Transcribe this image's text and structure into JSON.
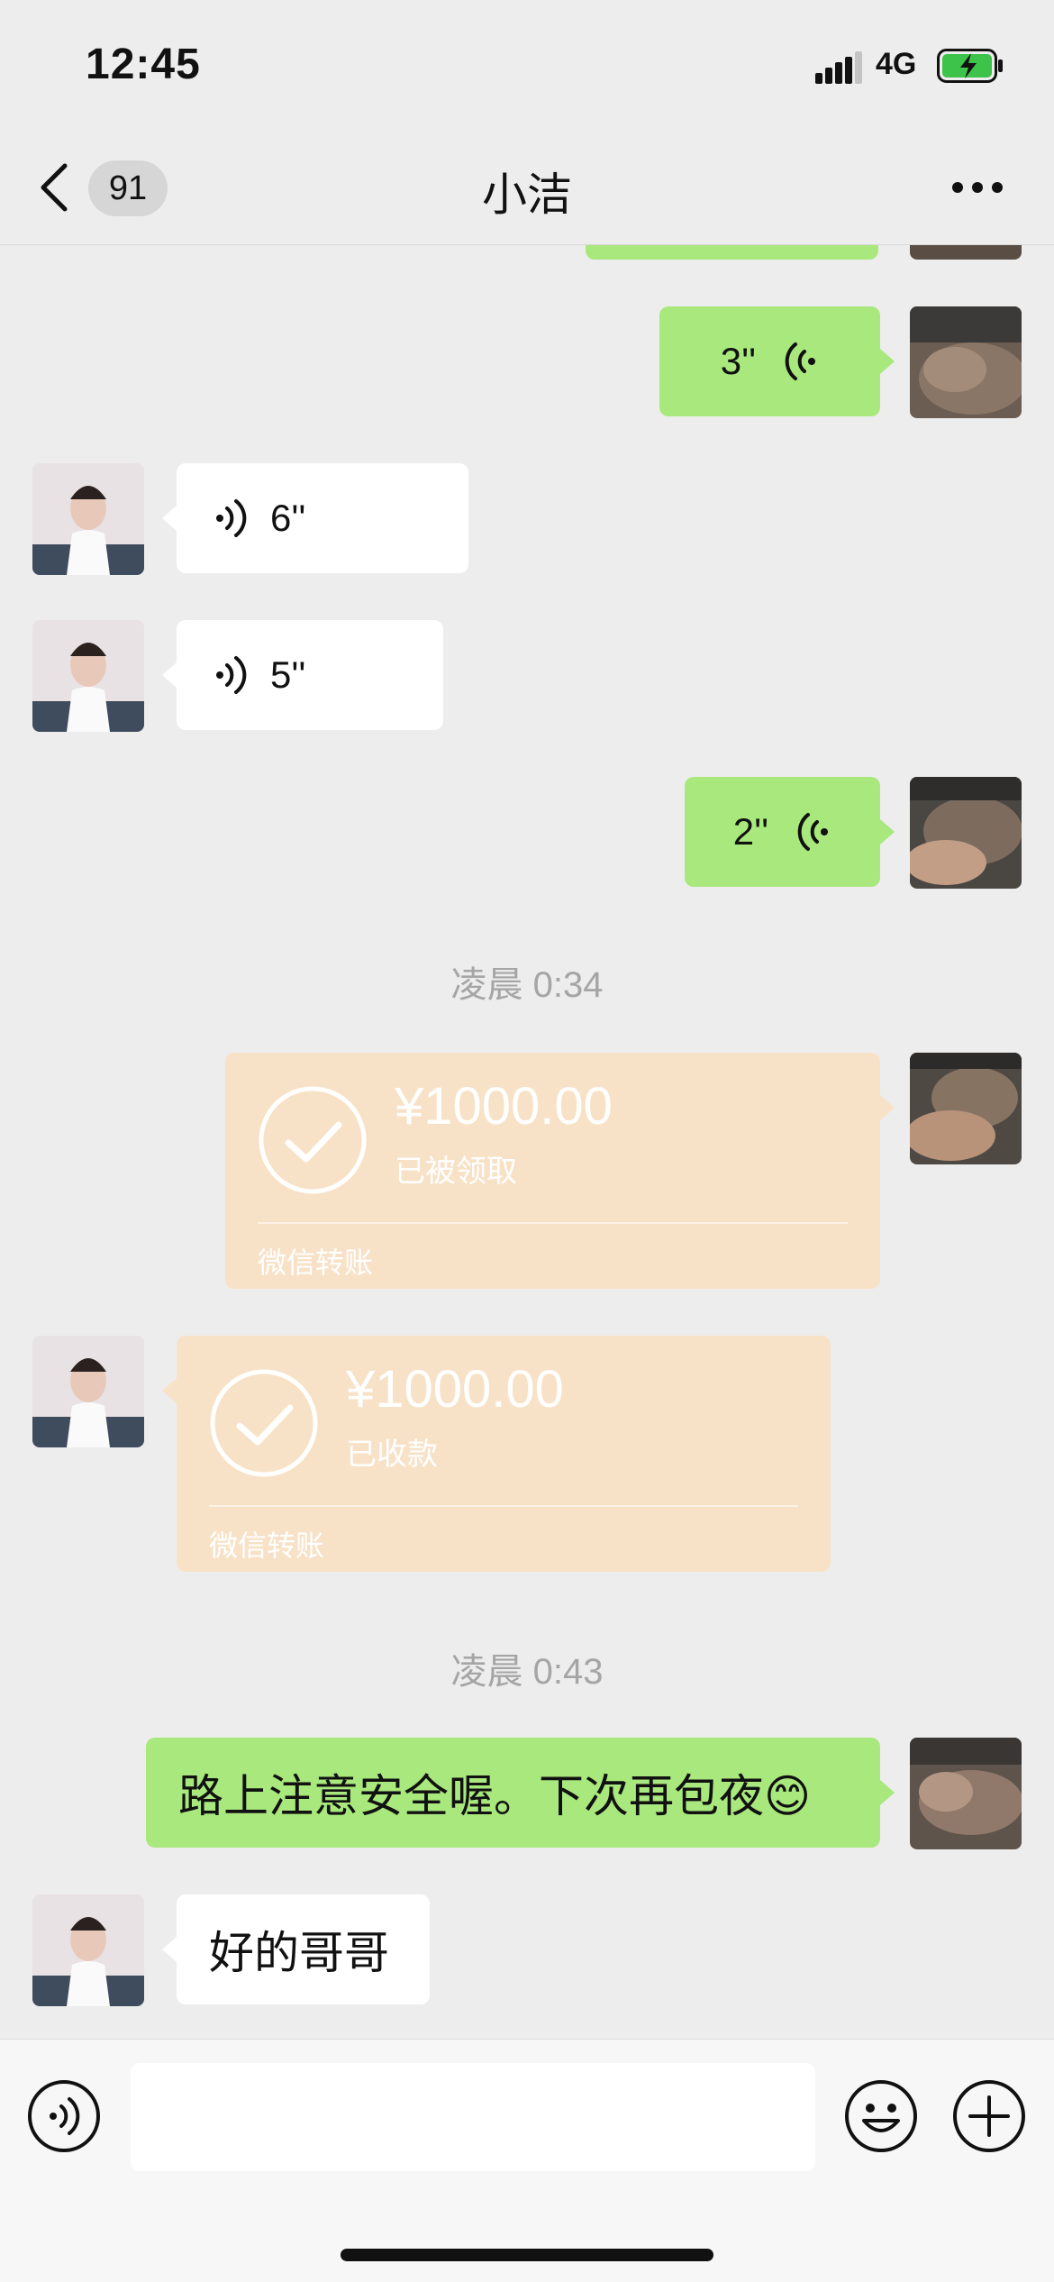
{
  "status_bar": {
    "time": "12:45",
    "network": "4G"
  },
  "header": {
    "unread_count": "91",
    "title": "小洁"
  },
  "messages": [
    {
      "type": "voice",
      "side": "right",
      "duration": "3''"
    },
    {
      "type": "voice",
      "side": "left",
      "duration": "6''"
    },
    {
      "type": "voice",
      "side": "left",
      "duration": "5''"
    },
    {
      "type": "voice",
      "side": "right",
      "duration": "2''"
    },
    {
      "type": "time",
      "text": "凌晨 0:34"
    },
    {
      "type": "transfer",
      "side": "right",
      "amount": "¥1000.00",
      "status": "已被领取",
      "label": "微信转账"
    },
    {
      "type": "transfer",
      "side": "left",
      "amount": "¥1000.00",
      "status": "已收款",
      "label": "微信转账"
    },
    {
      "type": "time",
      "text": "凌晨 0:43"
    },
    {
      "type": "text",
      "side": "right",
      "text": "路上注意安全喔。下次再包夜😊"
    },
    {
      "type": "text",
      "side": "left",
      "text": "好的哥哥"
    }
  ],
  "colors": {
    "sent_bubble": "#a9e87d",
    "received_bubble": "#ffffff",
    "transfer_bubble": "#f8e2c7",
    "background": "#ededed"
  }
}
